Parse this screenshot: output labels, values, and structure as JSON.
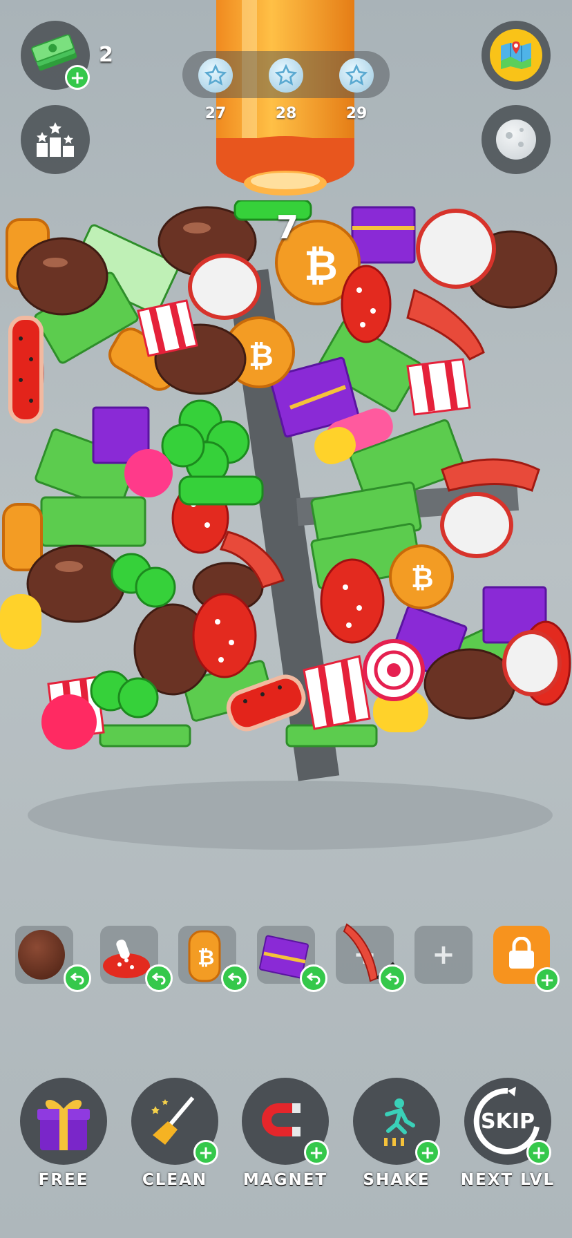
{
  "hud": {
    "cash_count": "2",
    "level_remaining": "7",
    "milestones": [
      {
        "label": "27"
      },
      {
        "label": "28"
      },
      {
        "label": "29"
      }
    ]
  },
  "tray": {
    "slots": [
      {
        "item": "chocolate-item",
        "undo": true
      },
      {
        "item": "mushroom-item",
        "undo": true
      },
      {
        "item": "coin-item",
        "undo": true
      },
      {
        "item": "gift-item",
        "undo": true
      },
      {
        "item": "heel-item",
        "undo": true
      },
      {
        "item": "empty",
        "undo": false
      }
    ]
  },
  "boosters": {
    "free_label": "FREE",
    "clean_label": "CLEAN",
    "magnet_label": "MAGNET",
    "shake_label": "SHAKE",
    "next_label": "NEXT LVL",
    "skip_text": "SKIP"
  },
  "colors": {
    "accent_green": "#35c84b",
    "lock_orange": "#f7931e",
    "button_dark": "#4a4f54"
  }
}
